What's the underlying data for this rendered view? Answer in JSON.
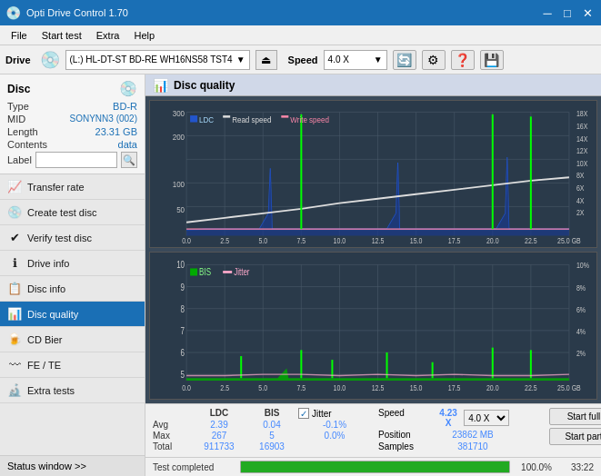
{
  "app": {
    "title": "Opti Drive Control 1.70",
    "title_icon": "💿"
  },
  "titlebar": {
    "minimize": "─",
    "maximize": "□",
    "close": "✕"
  },
  "menubar": {
    "items": [
      "File",
      "Start test",
      "Extra",
      "Help"
    ]
  },
  "drive_bar": {
    "label": "Drive",
    "drive_value": "(L:)  HL-DT-ST BD-RE  WH16NS58 TST4",
    "speed_label": "Speed",
    "speed_value": "4.0 X"
  },
  "disc": {
    "label": "Disc",
    "type_key": "Type",
    "type_val": "BD-R",
    "mid_key": "MID",
    "mid_val": "SONYNN3 (002)",
    "length_key": "Length",
    "length_val": "23.31 GB",
    "contents_key": "Contents",
    "contents_val": "data",
    "label_key": "Label",
    "label_placeholder": ""
  },
  "nav": {
    "items": [
      {
        "id": "transfer-rate",
        "label": "Transfer rate",
        "icon": "📈"
      },
      {
        "id": "create-test-disc",
        "label": "Create test disc",
        "icon": "💿"
      },
      {
        "id": "verify-test-disc",
        "label": "Verify test disc",
        "icon": "✔"
      },
      {
        "id": "drive-info",
        "label": "Drive info",
        "icon": "ℹ"
      },
      {
        "id": "disc-info",
        "label": "Disc info",
        "icon": "📋"
      },
      {
        "id": "disc-quality",
        "label": "Disc quality",
        "icon": "📊",
        "active": true
      },
      {
        "id": "cd-bier",
        "label": "CD Bier",
        "icon": "🍺"
      },
      {
        "id": "fe-te",
        "label": "FE / TE",
        "icon": "〰"
      },
      {
        "id": "extra-tests",
        "label": "Extra tests",
        "icon": "🔬"
      }
    ],
    "status_window": "Status window >> "
  },
  "disc_quality": {
    "title": "Disc quality",
    "chart1": {
      "legend": [
        "LDC",
        "Read speed",
        "Write speed"
      ],
      "y_max": 300,
      "y_right_labels": [
        "18X",
        "16X",
        "14X",
        "12X",
        "10X",
        "8X",
        "6X",
        "4X",
        "2X"
      ],
      "x_labels": [
        "0.0",
        "2.5",
        "5.0",
        "7.5",
        "10.0",
        "12.5",
        "15.0",
        "17.5",
        "20.0",
        "22.5",
        "25.0 GB"
      ]
    },
    "chart2": {
      "legend": [
        "BIS",
        "Jitter"
      ],
      "y_max": 10,
      "y_right_labels": [
        "10%",
        "8%",
        "6%",
        "4%",
        "2%"
      ],
      "x_labels": [
        "0.0",
        "2.5",
        "5.0",
        "7.5",
        "10.0",
        "12.5",
        "15.0",
        "17.5",
        "20.0",
        "22.5",
        "25.0 GB"
      ]
    }
  },
  "stats": {
    "headers": [
      "",
      "LDC",
      "BIS",
      "",
      "Jitter",
      "Speed",
      ""
    ],
    "avg_label": "Avg",
    "avg_ldc": "2.39",
    "avg_bis": "0.04",
    "avg_jitter": "-0.1%",
    "max_label": "Max",
    "max_ldc": "267",
    "max_bis": "5",
    "max_jitter": "0.0%",
    "total_label": "Total",
    "total_ldc": "911733",
    "total_bis": "16903",
    "jitter_label": "Jitter",
    "jitter_checked": true,
    "speed_label": "Speed",
    "speed_val": "4.23 X",
    "speed_combo": "4.0 X",
    "position_label": "Position",
    "position_val": "23862 MB",
    "samples_label": "Samples",
    "samples_val": "381710",
    "btn_start_full": "Start full",
    "btn_start_part": "Start part"
  },
  "progress": {
    "status": "Test completed",
    "percent": 100,
    "percent_label": "100.0%",
    "time": "33:22"
  }
}
